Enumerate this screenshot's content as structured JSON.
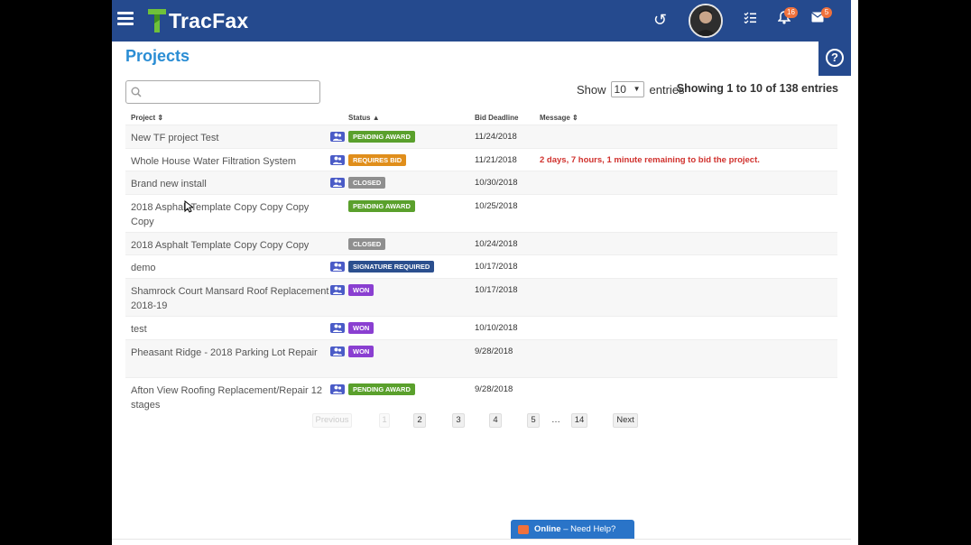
{
  "header": {
    "logo_text": "TracFax",
    "notifications_count": "16",
    "messages_count": "5",
    "accent_color": "#254a8e",
    "badge_color": "#f0713c"
  },
  "page_title": "Projects",
  "search": {
    "placeholder": "",
    "value": ""
  },
  "entries": {
    "show_label": "Show",
    "selected": "10",
    "entries_label": "entries",
    "summary": "Showing 1 to 10 of 138 entries"
  },
  "table": {
    "columns": {
      "project": "Project",
      "status": "Status",
      "bid_deadline": "Bid Deadline",
      "message": "Message"
    },
    "rows": [
      {
        "project": "New TF project Test",
        "team_icon": true,
        "status": "PENDING AWARD",
        "status_color": "#5aa02c",
        "deadline": "11/24/2018",
        "message": ""
      },
      {
        "project": "Whole House Water Filtration System",
        "team_icon": true,
        "status": "REQUIRES BID",
        "status_color": "#e08e1b",
        "deadline": "11/21/2018",
        "message": "2 days, 7 hours, 1 minute remaining to bid the project."
      },
      {
        "project": "Brand new install",
        "team_icon": true,
        "status": "CLOSED",
        "status_color": "#8f8f8f",
        "deadline": "10/30/2018",
        "message": ""
      },
      {
        "project": "2018 Asphalt Template Copy Copy Copy Copy",
        "team_icon": false,
        "status": "PENDING AWARD",
        "status_color": "#5aa02c",
        "deadline": "10/25/2018",
        "message": ""
      },
      {
        "project": "2018 Asphalt Template Copy Copy Copy",
        "team_icon": false,
        "status": "CLOSED",
        "status_color": "#8f8f8f",
        "deadline": "10/24/2018",
        "message": ""
      },
      {
        "project": "demo",
        "team_icon": true,
        "status": "SIGNATURE REQUIRED",
        "status_color": "#2b4f8e",
        "deadline": "10/17/2018",
        "message": ""
      },
      {
        "project": "Shamrock Court Mansard Roof Replacement 2018-19",
        "team_icon": true,
        "status": "WON",
        "status_color": "#8a3fd1",
        "deadline": "10/17/2018",
        "message": ""
      },
      {
        "project": "test",
        "team_icon": true,
        "status": "WON",
        "status_color": "#8a3fd1",
        "deadline": "10/10/2018",
        "message": ""
      },
      {
        "project": "Pheasant Ridge - 2018 Parking Lot Repair",
        "team_icon": true,
        "status": "WON",
        "status_color": "#8a3fd1",
        "deadline": "9/28/2018",
        "message": ""
      },
      {
        "project": "Afton View Roofing Replacement/Repair 12 stages",
        "team_icon": true,
        "status": "PENDING AWARD",
        "status_color": "#5aa02c",
        "deadline": "9/28/2018",
        "message": ""
      }
    ]
  },
  "pagination": {
    "previous": "Previous",
    "pages": [
      "1",
      "2",
      "3",
      "4",
      "5"
    ],
    "ellipsis": "…",
    "last": "14",
    "next": "Next",
    "current": "1"
  },
  "chat": {
    "status": "Online",
    "text": "Need Help?"
  }
}
